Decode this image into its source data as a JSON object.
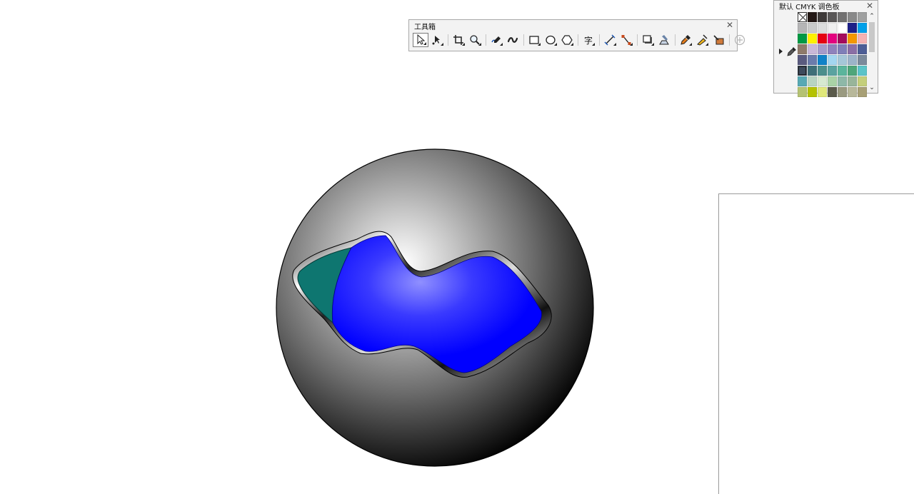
{
  "toolbox": {
    "title": "工具箱",
    "tools": [
      {
        "name": "pick-tool",
        "icon": "arrow-pointer-icon",
        "active": true,
        "flyout": true
      },
      {
        "name": "shape-tool",
        "icon": "shape-node-icon",
        "flyout": true
      },
      {
        "name": "crop-tool",
        "icon": "crop-icon",
        "flyout": true
      },
      {
        "name": "zoom-tool",
        "icon": "zoom-icon",
        "flyout": true
      },
      {
        "name": "freehand-tool",
        "icon": "freehand-icon",
        "flyout": true
      },
      {
        "name": "artistic-media-tool",
        "icon": "artistic-media-icon",
        "flyout": false
      },
      {
        "name": "rectangle-tool",
        "icon": "rectangle-icon",
        "flyout": true
      },
      {
        "name": "ellipse-tool",
        "icon": "ellipse-icon",
        "flyout": true
      },
      {
        "name": "polygon-tool",
        "icon": "polygon-icon",
        "flyout": true
      },
      {
        "name": "text-tool",
        "icon": "text-icon",
        "label": "字",
        "flyout": true
      },
      {
        "name": "dimension-tool",
        "icon": "parallel-dimension-icon",
        "flyout": true
      },
      {
        "name": "connector-tool",
        "icon": "connector-icon",
        "flyout": true
      },
      {
        "name": "drop-shadow-tool",
        "icon": "drop-shadow-icon",
        "flyout": true
      },
      {
        "name": "transparency-tool",
        "icon": "transparency-icon",
        "flyout": false
      },
      {
        "name": "color-eyedropper-tool",
        "icon": "eyedropper-icon",
        "flyout": true
      },
      {
        "name": "interactive-fill-tool",
        "icon": "interactive-fill-icon",
        "flyout": true
      },
      {
        "name": "smart-fill-tool",
        "icon": "smart-fill-icon",
        "flyout": false
      },
      {
        "name": "add-tool",
        "icon": "plus-circle-icon",
        "flyout": false
      }
    ]
  },
  "palette": {
    "title": "默认 CMYK 调色板",
    "scroll_up": "⌃",
    "scroll_down": "⌄",
    "swatches": [
      "none",
      "#231815",
      "#3e3a39",
      "#595757",
      "#727171",
      "#898989",
      "#9fa0a0",
      "#b5b5b6",
      "#c9caca",
      "#dcdddd",
      "#efefef",
      "#ffffff",
      "#1d2088",
      "#00a0e9",
      "#009944",
      "#fff100",
      "#e60012",
      "#e4007f",
      "#a40b5d",
      "#f39800",
      "#f5b2b2",
      "#8f7a6a",
      "#c9b8d8",
      "#a59aca",
      "#8f82bc",
      "#7f7fb8",
      "#8a6fa5",
      "#4d5e96",
      "#5a5b7f",
      "#6b7cac",
      "#0f82c8",
      "#a3d6f0",
      "#a5c7d8",
      "#9cb4c9",
      "#7b8a9b",
      "#3d4a5c",
      "#3f6f78",
      "#4b8f8c",
      "#5aa3a0",
      "#5bb59c",
      "#4fa67a",
      "#5bc4c8",
      "#57a9b4",
      "#b8d4c2",
      "#d6e9d0",
      "#a9d3a6",
      "#8eb8a8",
      "#98b59a",
      "#c4cf7a",
      "#b5c273",
      "#b5c200",
      "#e0e87a",
      "#5a5a4a",
      "#9a9a80",
      "#b8b89a",
      "#a8a076"
    ],
    "selected_index": 35
  },
  "canvas": {
    "sphere_fill": "radial-gradient white to black",
    "blob_fill": "#0000ff",
    "blob_highlight": "#8c8cff",
    "teal_fill": "#0e7670"
  }
}
